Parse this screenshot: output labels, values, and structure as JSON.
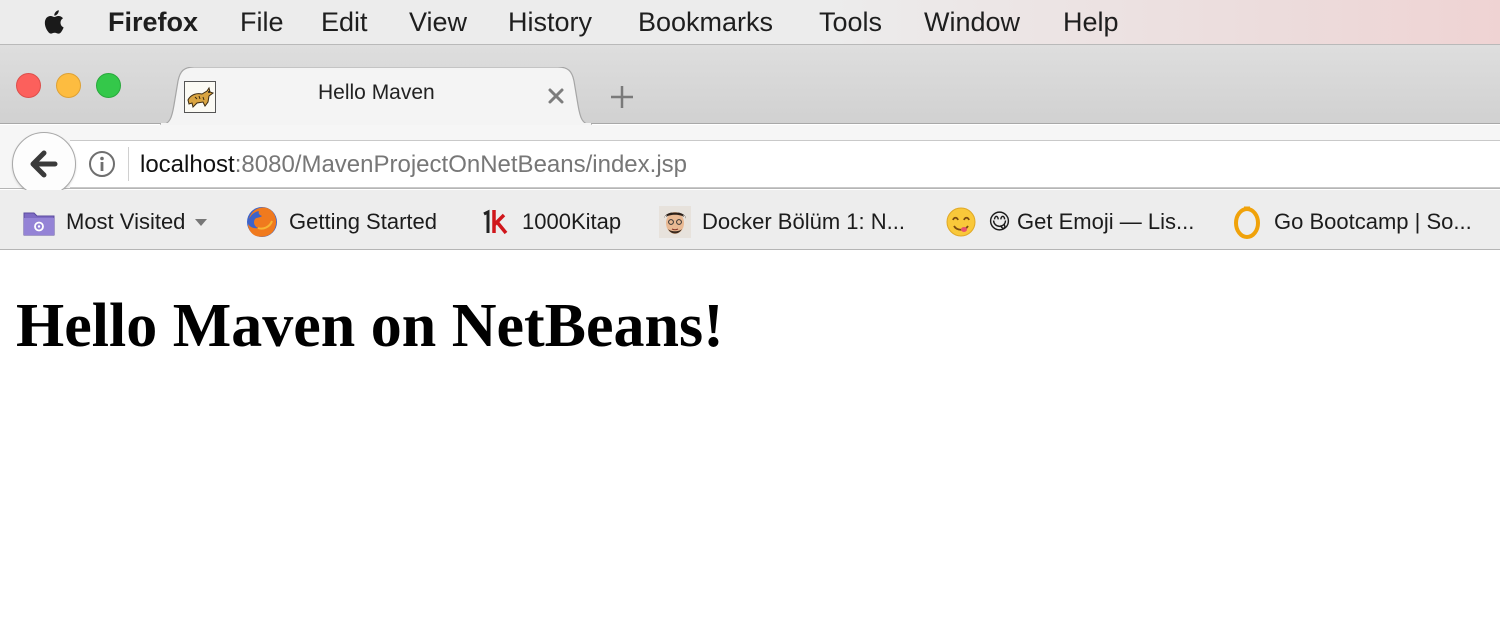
{
  "menubar": {
    "app_name": "Firefox",
    "items": [
      "File",
      "Edit",
      "View",
      "History",
      "Bookmarks",
      "Tools",
      "Window",
      "Help"
    ]
  },
  "tab": {
    "title": "Hello Maven",
    "favicon": "tomcat-icon"
  },
  "navbar": {
    "url_host": "localhost",
    "url_rest": ":8080/MavenProjectOnNetBeans/index.jsp"
  },
  "bookmarks": [
    {
      "label": "Most Visited",
      "icon": "folder-icon"
    },
    {
      "label": "Getting Started",
      "icon": "firefox-icon"
    },
    {
      "label": "1000Kitap",
      "icon": "1k-icon"
    },
    {
      "label": "Docker Bölüm 1: N...",
      "icon": "avatar-icon"
    },
    {
      "label": "😋 Get Emoji — Lis...",
      "icon": "emoji-icon"
    },
    {
      "label": "Go Bootcamp | So...",
      "icon": "go-bootcamp-icon"
    }
  ],
  "content": {
    "heading": "Hello Maven on NetBeans!"
  },
  "colors": {
    "close": "#fc605c",
    "minimize": "#fdbc40",
    "maximize": "#34c84a"
  }
}
